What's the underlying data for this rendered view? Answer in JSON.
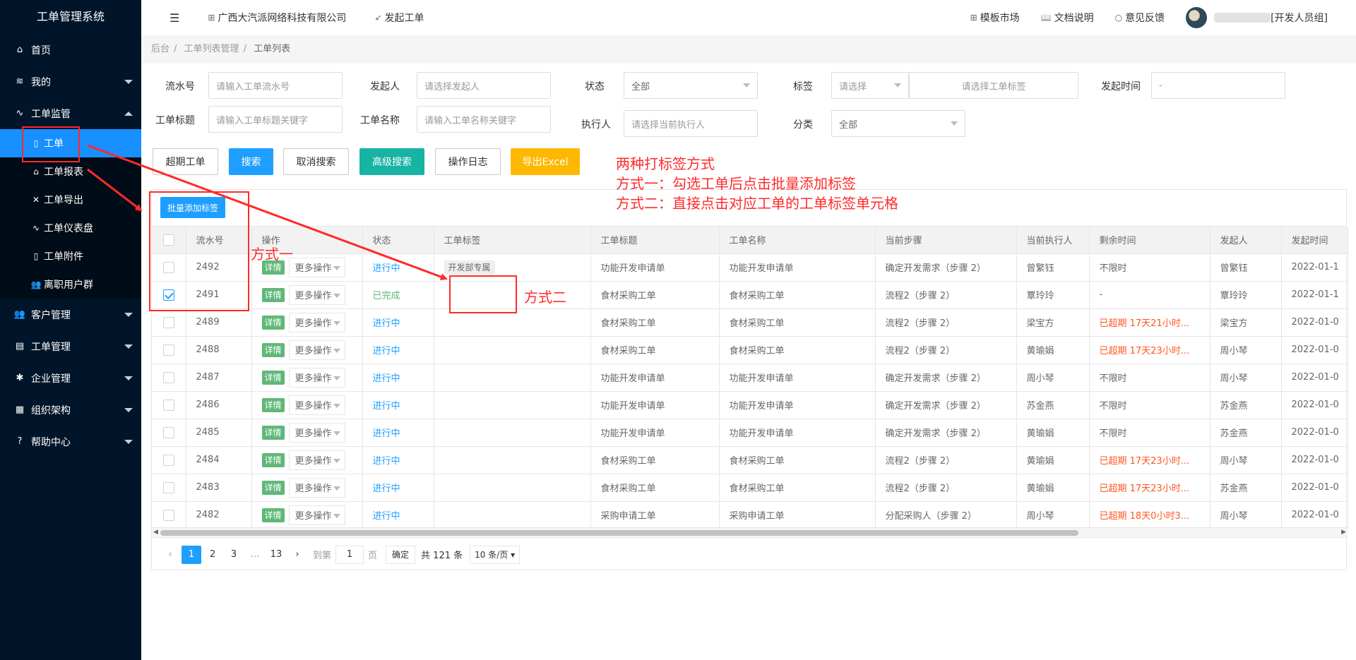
{
  "sidebar": {
    "title": "工单管理系统",
    "items": [
      {
        "label": "首页",
        "icon": "home-icon"
      },
      {
        "label": "我的",
        "icon": "layers-icon"
      },
      {
        "label": "工单监管",
        "icon": "pulse-icon"
      },
      {
        "label": "客户管理",
        "icon": "users-icon"
      },
      {
        "label": "工单管理",
        "icon": "doc-icon"
      },
      {
        "label": "企业管理",
        "icon": "gear-icon"
      },
      {
        "label": "组织架构",
        "icon": "calendar-icon"
      },
      {
        "label": "帮助中心",
        "icon": "question-icon"
      }
    ],
    "subitems": [
      {
        "label": "工单",
        "icon": "file-icon"
      },
      {
        "label": "工单报表",
        "icon": "home-outline-icon"
      },
      {
        "label": "工单导出",
        "icon": "cross-icon"
      },
      {
        "label": "工单仪表盘",
        "icon": "pulse-icon"
      },
      {
        "label": "工单附件",
        "icon": "file-icon"
      },
      {
        "label": "离职用户群",
        "icon": "users-icon"
      }
    ]
  },
  "header": {
    "company": "广西大汽派网络科技有限公司",
    "start": "发起工单",
    "template_market": "模板市场",
    "docs": "文档说明",
    "feedback": "意见反馈",
    "user_group": "[开发人员组]"
  },
  "breadcrumb": [
    "后台",
    "工单列表管理",
    "工单列表"
  ],
  "filters": {
    "serial_label": "流水号",
    "serial_ph": "请输入工单流水号",
    "initiator_label": "发起人",
    "initiator_ph": "请选择发起人",
    "status_label": "状态",
    "status_val": "全部",
    "tag_label": "标签",
    "tag_sel": "请选择",
    "tag_ph": "请选择工单标签",
    "time_label": "发起时间",
    "time_val": "-",
    "title_label": "工单标题",
    "title_ph": "请输入工单标题关键字",
    "name_label": "工单名称",
    "name_ph": "请输入工单名称关键字",
    "executor_label": "执行人",
    "executor_ph": "请选择当前执行人",
    "category_label": "分类",
    "category_val": "全部"
  },
  "buttons": {
    "overdue": "超期工单",
    "search": "搜索",
    "cancel": "取消搜索",
    "advanced": "高级搜索",
    "log": "操作日志",
    "export": "导出Excel",
    "batch_tag": "批量添加标签"
  },
  "table": {
    "columns": [
      "流水号",
      "操作",
      "状态",
      "工单标签",
      "工单标题",
      "工单名称",
      "当前步骤",
      "当前执行人",
      "剩余时间",
      "发起人",
      "发起时间"
    ],
    "detail_label": "详情",
    "more_label": "更多操作",
    "rows": [
      {
        "id": "2492",
        "status": "进行中",
        "tag": "开发部专属",
        "title": "功能开发申请单",
        "name": "功能开发申请单",
        "step": "确定开发需求（步骤 2）",
        "executor": "曾繁钰",
        "remain": "不限时",
        "initiator": "曾繁钰",
        "time": "2022-01-1",
        "checked": false,
        "done": false,
        "overdue": false
      },
      {
        "id": "2491",
        "status": "已完成",
        "tag": "",
        "title": "食材采购工单",
        "name": "食材采购工单",
        "step": "流程2（步骤 2）",
        "executor": "覃玲玲",
        "remain": "-",
        "initiator": "覃玲玲",
        "time": "2022-01-1",
        "checked": true,
        "done": true,
        "overdue": false
      },
      {
        "id": "2489",
        "status": "进行中",
        "tag": "",
        "title": "食材采购工单",
        "name": "食材采购工单",
        "step": "流程2（步骤 2）",
        "executor": "梁宝方",
        "remain": "已超期 17天21小时...",
        "initiator": "梁宝方",
        "time": "2022-01-0",
        "checked": false,
        "done": false,
        "overdue": true
      },
      {
        "id": "2488",
        "status": "进行中",
        "tag": "",
        "title": "食材采购工单",
        "name": "食材采购工单",
        "step": "流程2（步骤 2）",
        "executor": "黄瑜娟",
        "remain": "已超期 17天23小时...",
        "initiator": "周小琴",
        "time": "2022-01-0",
        "checked": false,
        "done": false,
        "overdue": true
      },
      {
        "id": "2487",
        "status": "进行中",
        "tag": "",
        "title": "功能开发申请单",
        "name": "功能开发申请单",
        "step": "确定开发需求（步骤 2）",
        "executor": "周小琴",
        "remain": "不限时",
        "initiator": "周小琴",
        "time": "2022-01-0",
        "checked": false,
        "done": false,
        "overdue": false
      },
      {
        "id": "2486",
        "status": "进行中",
        "tag": "",
        "title": "功能开发申请单",
        "name": "功能开发申请单",
        "step": "确定开发需求（步骤 2）",
        "executor": "苏金燕",
        "remain": "不限时",
        "initiator": "苏金燕",
        "time": "2022-01-0",
        "checked": false,
        "done": false,
        "overdue": false
      },
      {
        "id": "2485",
        "status": "进行中",
        "tag": "",
        "title": "功能开发申请单",
        "name": "功能开发申请单",
        "step": "确定开发需求（步骤 2）",
        "executor": "黄瑜娟",
        "remain": "不限时",
        "initiator": "苏金燕",
        "time": "2022-01-0",
        "checked": false,
        "done": false,
        "overdue": false
      },
      {
        "id": "2484",
        "status": "进行中",
        "tag": "",
        "title": "食材采购工单",
        "name": "食材采购工单",
        "step": "流程2（步骤 2）",
        "executor": "黄瑜娟",
        "remain": "已超期 17天23小时...",
        "initiator": "周小琴",
        "time": "2022-01-0",
        "checked": false,
        "done": false,
        "overdue": true
      },
      {
        "id": "2483",
        "status": "进行中",
        "tag": "",
        "title": "食材采购工单",
        "name": "食材采购工单",
        "step": "流程2（步骤 2）",
        "executor": "黄瑜娟",
        "remain": "已超期 17天23小时...",
        "initiator": "苏金燕",
        "time": "2022-01-0",
        "checked": false,
        "done": false,
        "overdue": true
      },
      {
        "id": "2482",
        "status": "进行中",
        "tag": "",
        "title": "采购申请工单",
        "name": "采购申请工单",
        "step": "分配采购人（步骤 2）",
        "executor": "周小琴",
        "remain": "已超期 18天0小时3...",
        "initiator": "周小琴",
        "time": "2022-01-0",
        "checked": false,
        "done": false,
        "overdue": true
      }
    ]
  },
  "pager": {
    "pages": [
      "1",
      "2",
      "3",
      "…",
      "13"
    ],
    "goto": "到第",
    "page_val": "1",
    "page_unit": "页",
    "confirm": "确定",
    "total": "共 121 条",
    "size": "10 条/页"
  },
  "annotations": {
    "title": "两种打标签方式",
    "way1": "方式一：勾选工单后点击批量添加标签",
    "way2": "方式二：直接点击对应工单的工单标签单元格",
    "label1": "方式一",
    "label2": "方式二"
  },
  "colors": {
    "sidebar_bg": "#001529",
    "active": "#1890ff",
    "primary": "#1e9fff",
    "annotation": "#ff2a2a"
  }
}
